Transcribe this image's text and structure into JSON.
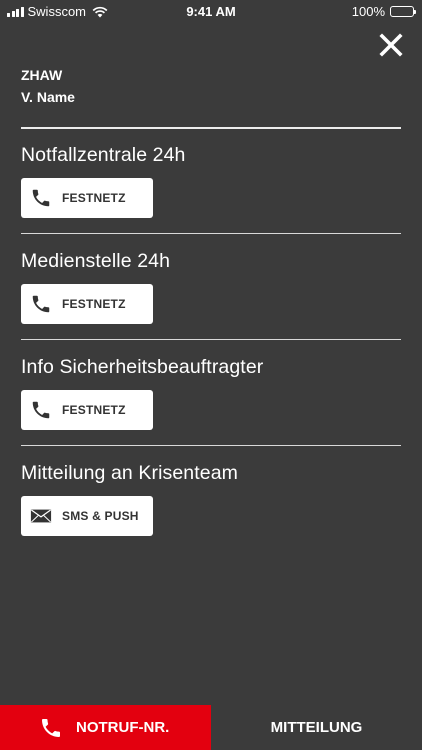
{
  "status_bar": {
    "carrier": "Swisscom",
    "time": "9:41 AM",
    "battery_percent": "100%"
  },
  "header": {
    "organization": "ZHAW",
    "user_name": "V. Name"
  },
  "sections": [
    {
      "title": "Notfallzentrale 24h",
      "button_label": "FESTNETZ",
      "button_icon": "phone-icon"
    },
    {
      "title": "Medienstelle 24h",
      "button_label": "FESTNETZ",
      "button_icon": "phone-icon"
    },
    {
      "title": "Info Sicherheitsbeauftragter",
      "button_label": "FESTNETZ",
      "button_icon": "phone-icon"
    },
    {
      "title": "Mitteilung an Krisenteam",
      "button_label": "SMS & PUSH",
      "button_icon": "envelope-icon"
    }
  ],
  "tab_bar": {
    "emergency_label": "NOTRUF-NR.",
    "message_label": "MITTEILUNG"
  },
  "colors": {
    "background": "#3b3b3b",
    "accent_red": "#e3000f",
    "button_bg": "#ffffff"
  }
}
